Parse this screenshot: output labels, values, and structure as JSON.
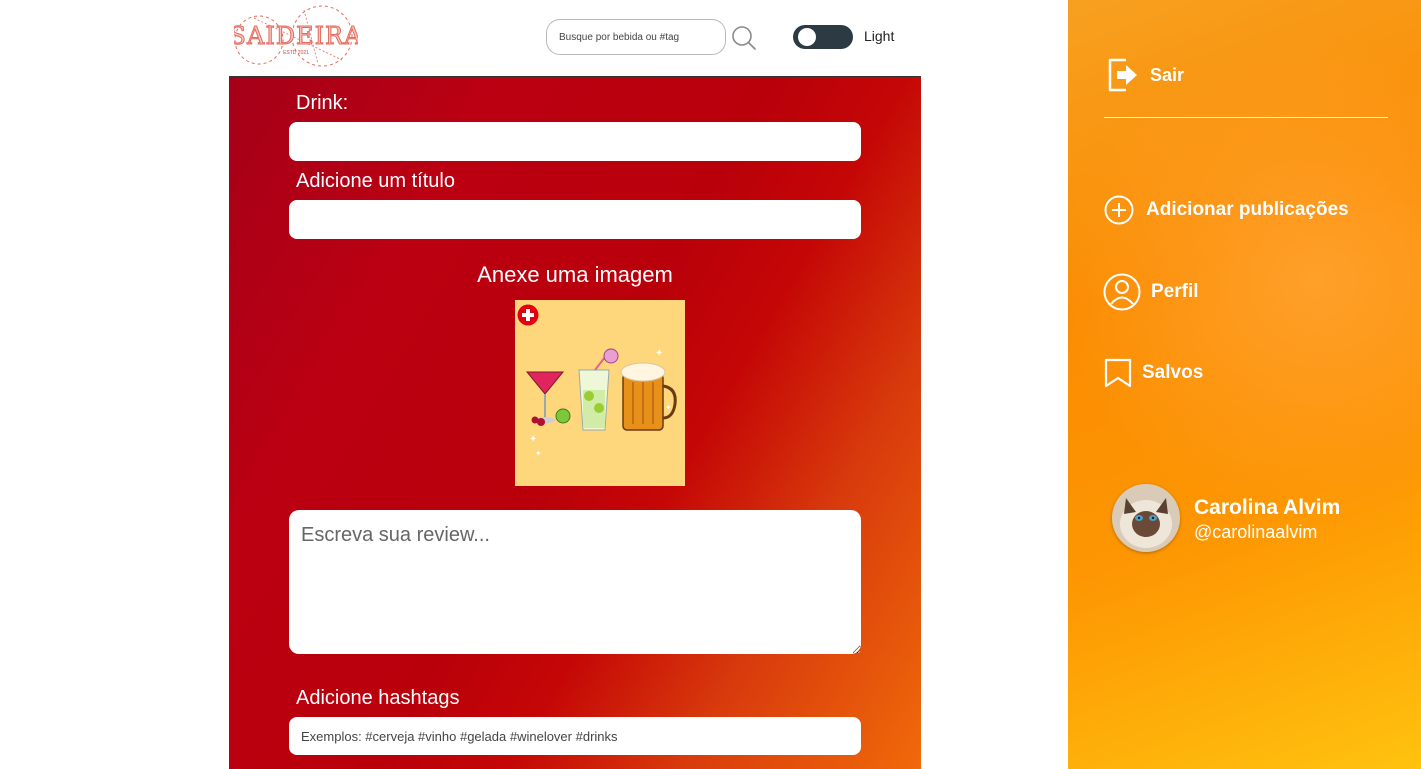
{
  "header": {
    "logo_text": "SAIDEIRA",
    "logo_subtext": "ESTD 2021",
    "search_placeholder": "Busque por bebida ou #tag",
    "theme_label": "Light"
  },
  "form": {
    "drink_label": "Drink:",
    "drink_value": "",
    "title_label": "Adicione um título",
    "title_value": "",
    "image_label": "Anexe uma imagem",
    "review_placeholder": "Escreva sua review...",
    "hashtags_label": "Adicione hashtags",
    "hashtags_placeholder": "Exemplos: #cerveja #vinho #gelada #winelover #drinks"
  },
  "sidebar": {
    "logout_label": "Sair",
    "items": [
      {
        "label": "Adicionar publicações",
        "icon": "plus-circle-icon"
      },
      {
        "label": "Perfil",
        "icon": "user-circle-icon"
      },
      {
        "label": "Salvos",
        "icon": "bookmark-icon"
      }
    ]
  },
  "user": {
    "name": "Carolina Alvim",
    "handle": "@carolinaalvim"
  },
  "colors": {
    "main_red": "#b9000a",
    "sidebar_orange": "#fb8c02",
    "toggle_dark": "#2c3a43",
    "image_bg": "#fed77c"
  }
}
